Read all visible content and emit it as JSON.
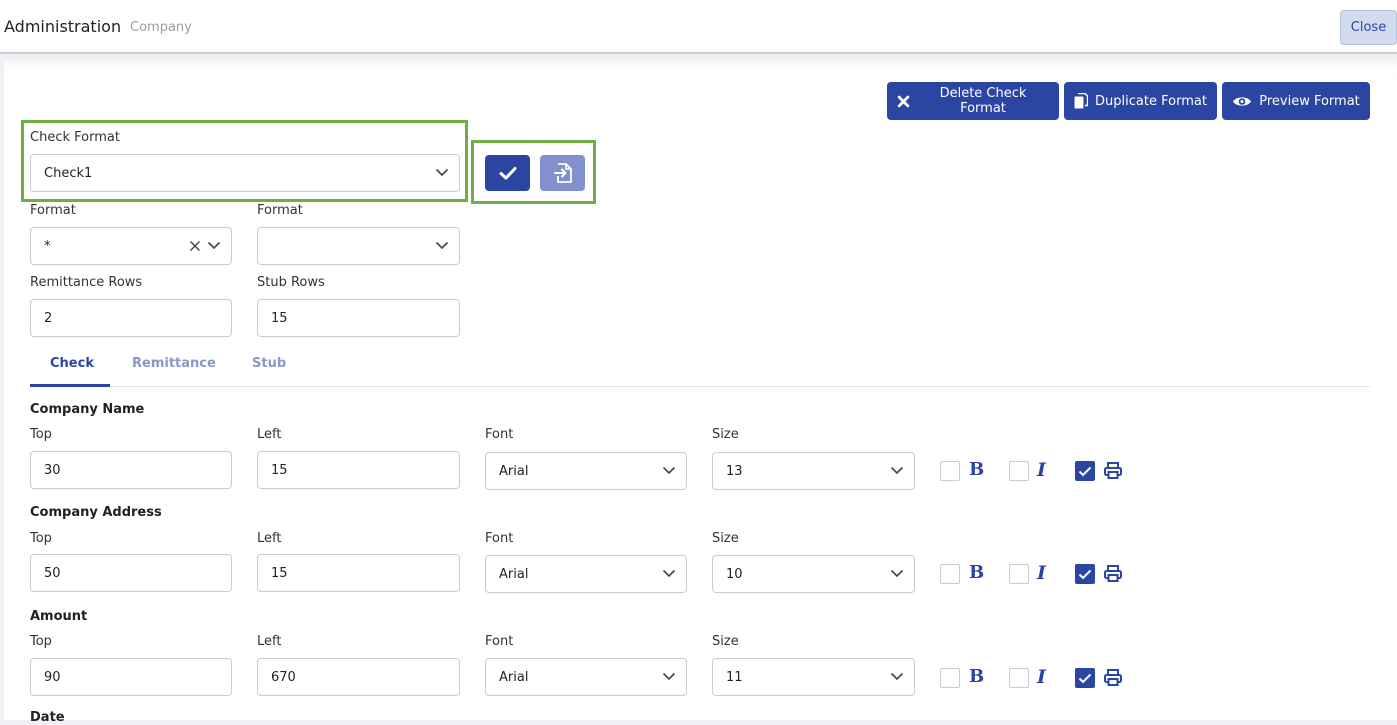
{
  "header": {
    "title": "Administration",
    "breadcrumb": "Company",
    "close_label": "Close"
  },
  "toolbar": {
    "delete_label": "Delete Check Format",
    "duplicate_label": "Duplicate Format",
    "preview_label": "Preview Format"
  },
  "check_format": {
    "label": "Check Format",
    "value": "Check1"
  },
  "format_left": {
    "label": "Format",
    "value": "*"
  },
  "format_right": {
    "label": "Format",
    "value": ""
  },
  "remittance_rows": {
    "label": "Remittance Rows",
    "value": "2"
  },
  "stub_rows": {
    "label": "Stub Rows",
    "value": "15"
  },
  "tabs": [
    {
      "label": "Check",
      "active": true
    },
    {
      "label": "Remittance",
      "active": false
    },
    {
      "label": "Stub",
      "active": false
    }
  ],
  "field_labels": {
    "top": "Top",
    "left": "Left",
    "font": "Font",
    "size": "Size"
  },
  "sections": [
    {
      "title": "Company Name",
      "top": "30",
      "left": "15",
      "font": "Arial",
      "size": "13",
      "bold": false,
      "italic": false,
      "print": true
    },
    {
      "title": "Company Address",
      "top": "50",
      "left": "15",
      "font": "Arial",
      "size": "10",
      "bold": false,
      "italic": false,
      "print": true
    },
    {
      "title": "Amount",
      "top": "90",
      "left": "670",
      "font": "Arial",
      "size": "11",
      "bold": false,
      "italic": false,
      "print": true
    },
    {
      "title": "Date"
    }
  ],
  "colors": {
    "primary": "#2b45a2",
    "secondary": "#8290cf",
    "highlight": "#6fae45"
  }
}
